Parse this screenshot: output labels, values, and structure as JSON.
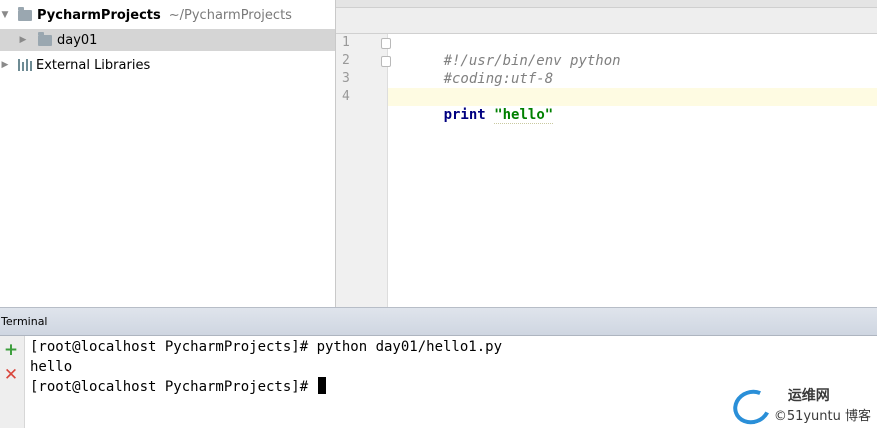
{
  "project_tree": {
    "root": {
      "name": "PycharmProjects",
      "path": "~/PycharmProjects",
      "icon": "folder-icon"
    },
    "items": [
      {
        "name": "day01",
        "icon": "folder-icon"
      },
      {
        "name": "External Libraries",
        "icon": "libraries-icon"
      }
    ]
  },
  "editor": {
    "line_numbers": [
      "1",
      "2",
      "3",
      "4"
    ],
    "lines": [
      {
        "comment": "#!/usr/bin/env python"
      },
      {
        "comment": "#coding:utf-8"
      },
      {
        "text": ""
      },
      {
        "keyword": "print",
        "string": "\"hello\""
      }
    ]
  },
  "terminal": {
    "title": "Terminal",
    "lines": [
      "[root@localhost PycharmProjects]# python day01/hello1.py",
      "hello",
      "[root@localhost PycharmProjects]# "
    ],
    "new_session_icon": "plus-icon",
    "close_session_icon": "close-icon"
  },
  "watermark": {
    "top": "运维网",
    "bottom": "©51yuntu 博客"
  },
  "colors": {
    "selection": "#d5d5d5",
    "keyword": "#000080",
    "string": "#008000",
    "comment": "#808080",
    "terminal_header": "#d7dde6"
  }
}
